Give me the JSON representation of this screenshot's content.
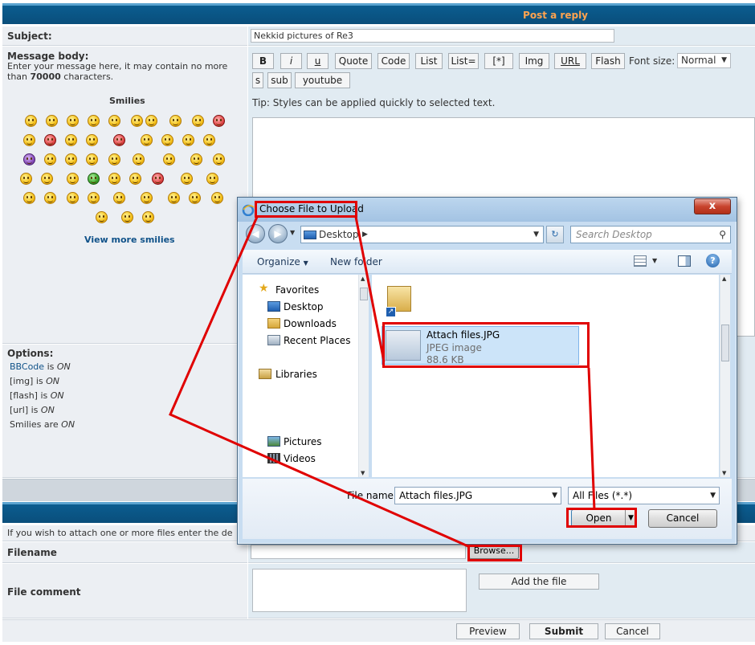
{
  "header": {
    "title": "Post a reply"
  },
  "form": {
    "subject_label": "Subject:",
    "subject_value": "Nekkid pictures of Re3",
    "message_label": "Message body:",
    "message_help": "Enter your message here, it may contain no more than",
    "message_limit": "70000",
    "message_help_suffix": "characters.",
    "smilies_title": "Smilies",
    "view_more_smilies": "View more smilies",
    "tip": "Tip: Styles can be applied quickly to selected text.",
    "font_size_label": "Font size:",
    "font_size_value": "Normal",
    "format_buttons": [
      "B",
      "i",
      "u",
      "Quote",
      "Code",
      "List",
      "List=",
      "[*]",
      "Img",
      "URL",
      "Flash"
    ],
    "format_buttons_row2": [
      "s",
      "sub",
      "youtube"
    ]
  },
  "options": {
    "title": "Options:",
    "bbcode_link": "BBCode",
    "is": "is",
    "on": "ON",
    "items": [
      "[img] is",
      "[flash] is",
      "[url] is",
      "Smilies are"
    ]
  },
  "attach": {
    "info": "If you wish to attach one or more files enter the de",
    "filename_label": "Filename",
    "browse": "Browse...",
    "comment_label": "File comment",
    "add_file": "Add the file"
  },
  "actions": {
    "preview": "Preview",
    "submit": "Submit",
    "cancel": "Cancel"
  },
  "dialog": {
    "title": "Choose File to Upload",
    "close": "x",
    "address": "Desktop",
    "search_placeholder": "Search Desktop",
    "organize": "Organize",
    "new_folder": "New folder",
    "nav": {
      "favorites": "Favorites",
      "desktop": "Desktop",
      "downloads": "Downloads",
      "recent": "Recent Places",
      "libraries": "Libraries",
      "pictures": "Pictures",
      "videos": "Videos"
    },
    "file": {
      "name": "Attach files.JPG",
      "type": "JPEG image",
      "size": "88.6 KB"
    },
    "filename_label": "File name:",
    "filename_value": "Attach files.JPG",
    "filter": "All Files (*.*)",
    "open": "Open",
    "cancel": "Cancel"
  },
  "colors": {
    "annotation": "#e00000",
    "header_bar": "#0a4e7b",
    "header_title": "#ffa34f"
  }
}
